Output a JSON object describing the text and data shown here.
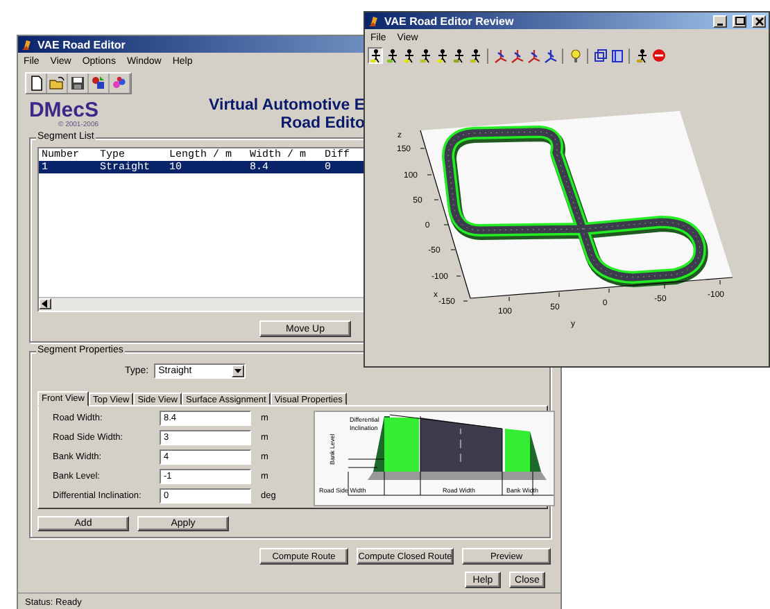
{
  "main_window": {
    "title": "VAE Road Editor",
    "menu": [
      "File",
      "View",
      "Options",
      "Window",
      "Help"
    ],
    "logo": {
      "text": "DMecS",
      "caption": "© 2001-2006"
    },
    "heading": [
      "Virtual Automotive E",
      "Road Edito"
    ],
    "segment_list": {
      "label": "Segment List",
      "columns": [
        "Number",
        "Type",
        "Length / m",
        "Width / m",
        "Diff"
      ],
      "rows": [
        {
          "cells": [
            "1",
            "Straight",
            "10",
            "8.4",
            "0"
          ],
          "selected": true
        }
      ],
      "buttons": [
        "Move Up"
      ]
    },
    "segment_properties": {
      "label": "Segment Properties",
      "type_label": "Type:",
      "type_value": "Straight",
      "tabs": [
        {
          "label": "Front View",
          "selected": true
        },
        {
          "label": "Top View",
          "selected": false
        },
        {
          "label": "Side View",
          "selected": false
        },
        {
          "label": "Surface Assignment",
          "selected": false
        },
        {
          "label": "Visual Properties",
          "selected": false
        }
      ],
      "fields": [
        {
          "label": "Road Width:",
          "value": "8.4",
          "unit": "m"
        },
        {
          "label": "Road Side Width:",
          "value": "3",
          "unit": "m"
        },
        {
          "label": "Bank Width:",
          "value": "4",
          "unit": "m"
        },
        {
          "label": "Bank Level:",
          "value": "-1",
          "unit": "m"
        },
        {
          "label": "Differential Inclination:",
          "value": "0",
          "unit": "deg"
        }
      ],
      "diagram": {
        "inclination": [
          "Differential",
          "Inclination"
        ],
        "bank_level": "Bank Level",
        "road_side_width": "Road Side Width",
        "road_width": "Road Width",
        "bank_width": "Bank Width"
      },
      "buttons": [
        "Add",
        "Apply"
      ]
    },
    "actions": [
      "Compute Route",
      "Compute Closed Route",
      "Preview"
    ],
    "dialog_buttons": [
      "Help",
      "Close"
    ],
    "status": "Status: Ready"
  },
  "review_window": {
    "title": "VAE Road Editor Review",
    "menu": [
      "File",
      "View"
    ],
    "plot": {
      "z_label": "z",
      "x_label": "x",
      "y_label": "y",
      "x_ticks": [
        "150",
        "100",
        "50",
        "0",
        "-50",
        "-100",
        "-150"
      ],
      "y_ticks": [
        "100",
        "50",
        "0",
        "-50",
        "-100"
      ]
    }
  }
}
